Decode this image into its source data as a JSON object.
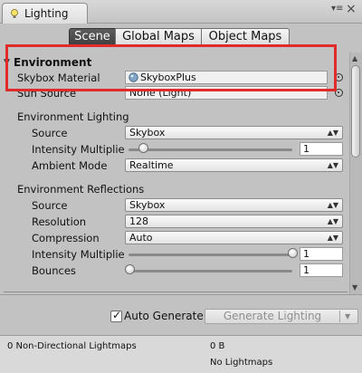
{
  "window": {
    "tab_title": "Lighting",
    "menu_glyph": "▾≡",
    "close_glyph": "×"
  },
  "toolbar": {
    "tabs": [
      {
        "label": "Scene",
        "active": true
      },
      {
        "label": "Global Maps",
        "active": false
      },
      {
        "label": "Object Maps",
        "active": false
      }
    ]
  },
  "environment": {
    "header": "Environment",
    "skybox_material_label": "Skybox Material",
    "skybox_material_value": "SkyboxPlus",
    "sun_source_label": "Sun Source",
    "sun_source_value": "None (Light)"
  },
  "environment_lighting": {
    "header": "Environment Lighting",
    "source_label": "Source",
    "source_value": "Skybox",
    "intensity_label": "Intensity Multiplie",
    "intensity_value": "1",
    "intensity_fraction": 0.0,
    "ambient_mode_label": "Ambient Mode",
    "ambient_mode_value": "Realtime"
  },
  "environment_reflections": {
    "header": "Environment Reflections",
    "source_label": "Source",
    "source_value": "Skybox",
    "resolution_label": "Resolution",
    "resolution_value": "128",
    "compression_label": "Compression",
    "compression_value": "Auto",
    "intensity_label": "Intensity Multiplie",
    "intensity_value": "1",
    "intensity_fraction": 1.0,
    "bounces_label": "Bounces",
    "bounces_value": "1",
    "bounces_fraction": 0.0
  },
  "bottom": {
    "auto_generate_label": "Auto Generate",
    "auto_generate_checked": true,
    "generate_button_label": "Generate Lighting"
  },
  "stats": {
    "lightmaps_label": "0 Non-Directional Lightmaps",
    "size_value": "0 B",
    "lightmaps_status": "No Lightmaps"
  },
  "colors": {
    "highlight": "#e02b2b",
    "active_tab": "#4a4a4a",
    "panel_bg": "#c2c2c2"
  },
  "icons": {
    "tab_icon": "lighting-icon",
    "skybox_icon": "material-sphere-icon",
    "picker_icon": "object-picker-icon",
    "dropdown_icon": "dropdown-arrow-icon"
  }
}
